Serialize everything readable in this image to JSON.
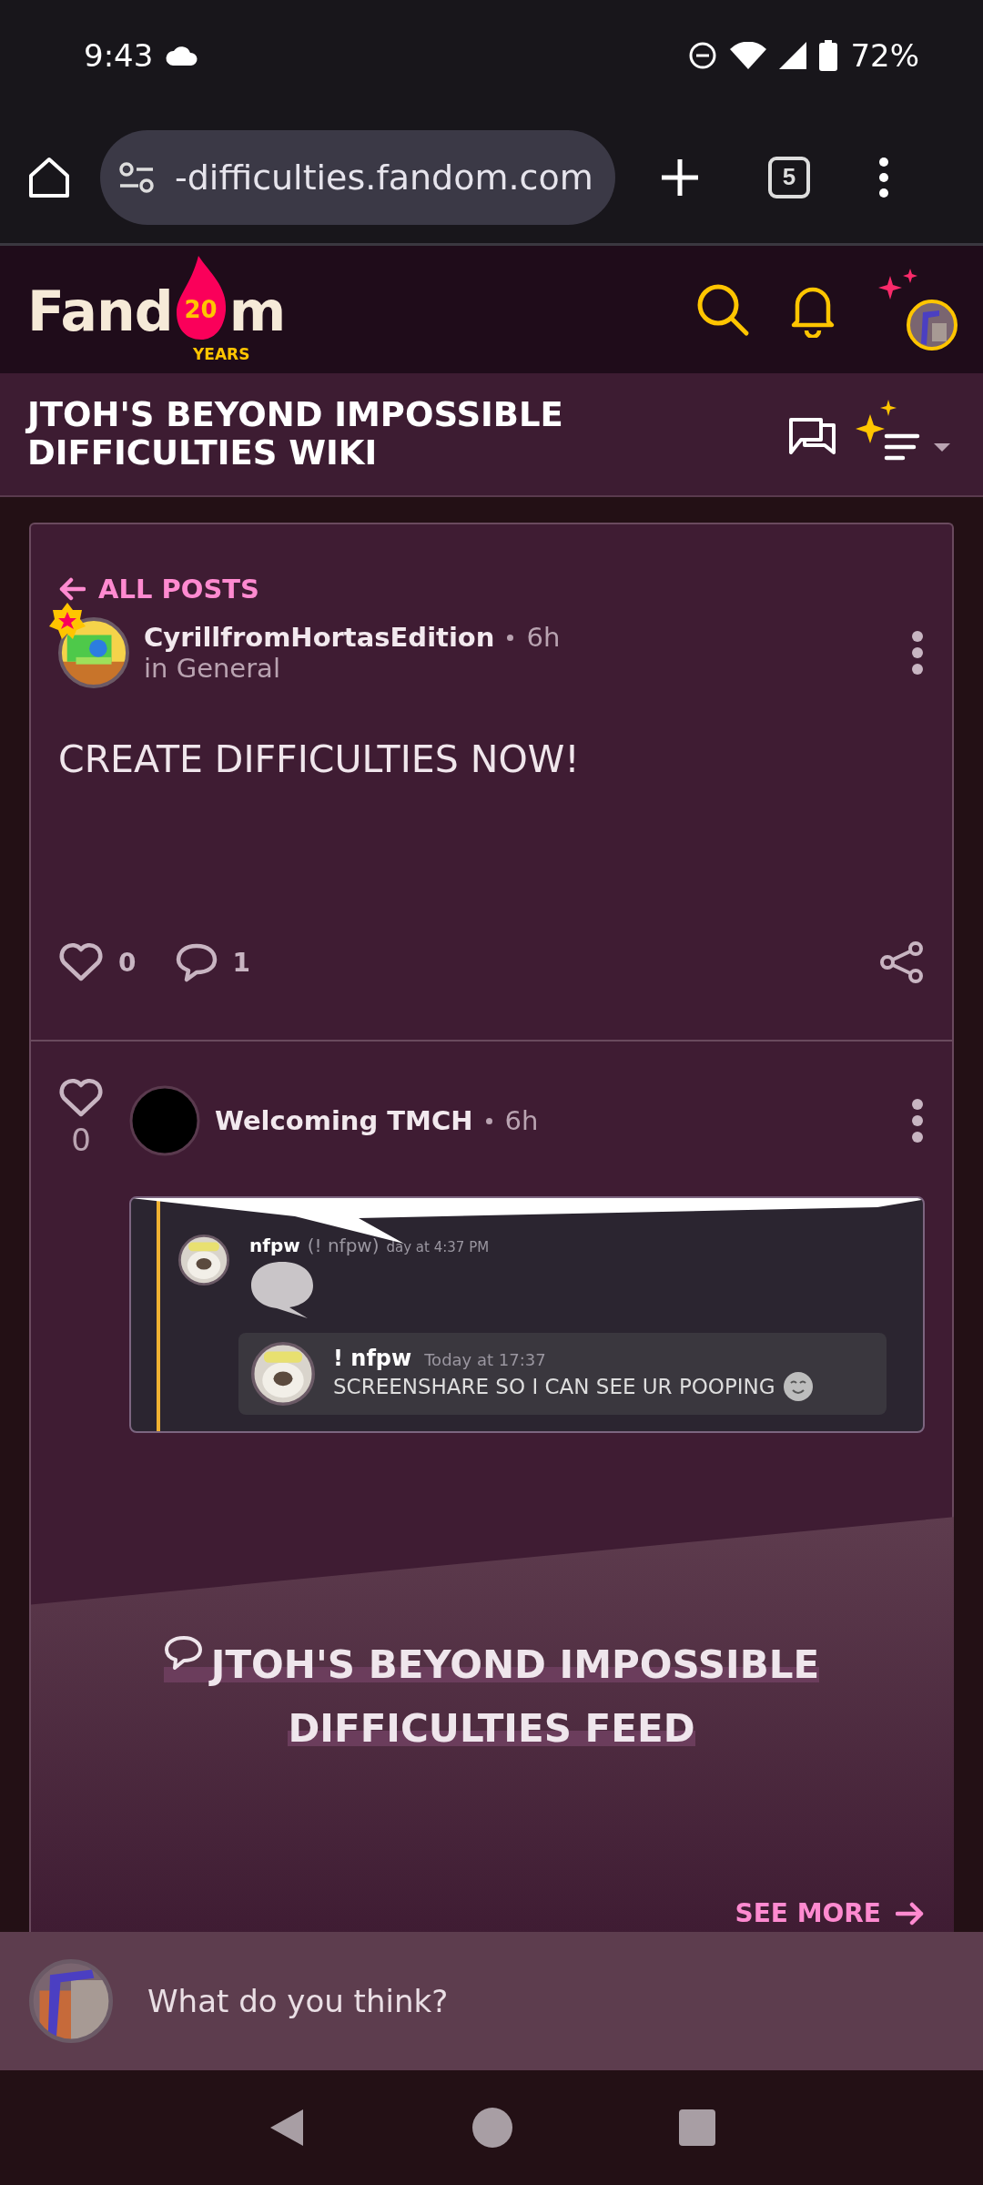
{
  "status_bar": {
    "time": "9:43",
    "battery": "72%"
  },
  "browser": {
    "url": "-difficulties.fandom.com",
    "tab_count": "5"
  },
  "fandom_header": {
    "logo_start": "Fand",
    "logo_badge": "20",
    "logo_end": "m",
    "logo_subtitle": "YEARS"
  },
  "wiki_title": "JTOH'S BEYOND IMPOSSIBLE DIFFICULTIES WIKI",
  "post": {
    "back_link": "ALL POSTS",
    "author": "CyrillfromHortasEdition",
    "time": "6h",
    "category": "in General",
    "body": "CREATE DIFFICULTIES NOW!",
    "likes": "0",
    "comments": "1"
  },
  "reply": {
    "likes": "0",
    "author": "Welcoming TMCH",
    "time": "6h",
    "attachment": {
      "author": "nfpw",
      "handle": "(! nfpw)",
      "time": "day at 4:37 PM",
      "quote_author": "! nfpw",
      "quote_time": "Today at 17:37",
      "quote_text": "SCREENSHARE SO I CAN SEE UR POOPING"
    }
  },
  "feed": {
    "title": "JTOH'S BEYOND IMPOSSIBLE DIFFICULTIES FEED",
    "see_more": "SEE MORE"
  },
  "comment_box": {
    "placeholder": "What do you think?"
  }
}
